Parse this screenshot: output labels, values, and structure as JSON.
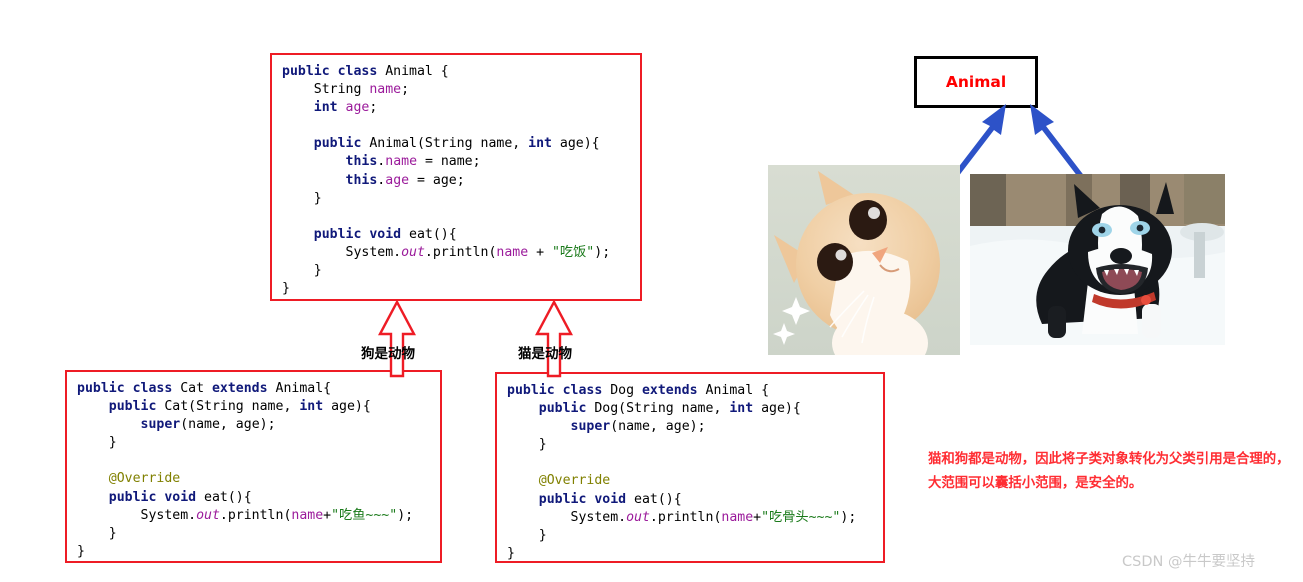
{
  "code_blocks": {
    "animal": {
      "title": "Animal base class",
      "lines": [
        "public class Animal {",
        "    String name;",
        "    int age;",
        "",
        "    public Animal(String name, int age){",
        "        this.name = name;",
        "        this.age = age;",
        "    }",
        "",
        "    public void eat(){",
        "        System.out.println(name + \"吃饭\");",
        "    }",
        "}"
      ]
    },
    "cat": {
      "title": "Cat subclass",
      "lines": [
        "public class Cat extends Animal{",
        "    public Cat(String name, int age){",
        "        super(name, age);",
        "    }",
        "",
        "    @Override",
        "    public void eat(){",
        "        System.out.println(name+\"吃鱼~~~\");",
        "    }",
        "}"
      ]
    },
    "dog": {
      "title": "Dog subclass",
      "lines": [
        "public class Dog extends Animal {",
        "    public Dog(String name, int age){",
        "        super(name, age);",
        "    }",
        "",
        "    @Override",
        "    public void eat(){",
        "        System.out.println(name+\"吃骨头~~~\");",
        "    }",
        "}"
      ]
    }
  },
  "arrow_labels": {
    "dog_is_animal": "狗是动物",
    "cat_is_animal": "猫是动物"
  },
  "diagram": {
    "parent_node_label": "Animal",
    "parent_node_color": "#ff0000",
    "arrow_color": "#2d52c8",
    "photos": {
      "cat_alt": "cat-photo",
      "dog_alt": "dog-photo"
    }
  },
  "note": {
    "line1": "猫和狗都是动物，因此将子类对象转化为父类引用是合理的，",
    "line2": "大范围可以囊括小范围，是安全的。",
    "color": "#ff2d33"
  },
  "watermark": {
    "text": "CSDN @牛牛要坚持"
  },
  "colors": {
    "code_border": "#ee1c25",
    "keyword": "#10197a",
    "field": "#9b1b9b",
    "string": "#1a7a1a",
    "annotation": "#808000",
    "node_border": "#000000"
  }
}
